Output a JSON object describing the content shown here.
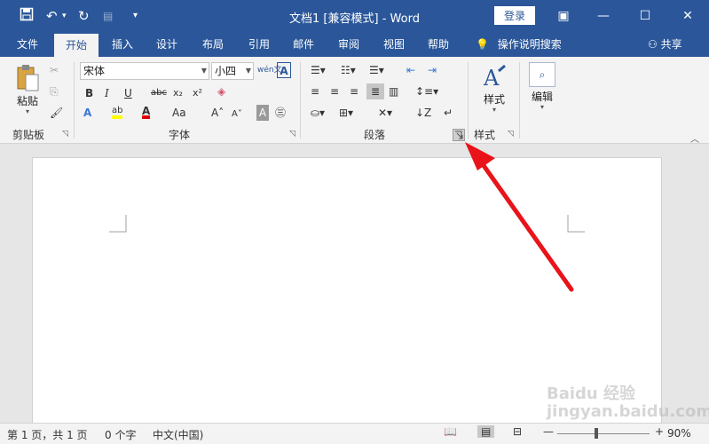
{
  "window": {
    "title": "文档1 [兼容模式]  -  Word",
    "login": "登录"
  },
  "tabs": [
    "文件",
    "开始",
    "插入",
    "设计",
    "布局",
    "引用",
    "邮件",
    "审阅",
    "视图",
    "帮助"
  ],
  "active_tab": "开始",
  "search_label": "操作说明搜索",
  "share_label": "共享",
  "ribbon": {
    "clipboard": {
      "label": "剪贴板",
      "paste": "粘贴"
    },
    "font": {
      "label": "字体",
      "name": "宋体",
      "size": "小四"
    },
    "paragraph": {
      "label": "段落"
    },
    "styles": {
      "label": "样式",
      "button": "样式"
    },
    "editing": {
      "button": "编辑"
    }
  },
  "status": {
    "page": "第 1 页，共 1 页",
    "words": "0 个字",
    "language": "中文(中国)",
    "zoom": "90%"
  },
  "watermark": "Baidu 经验  jingyan.baidu.com",
  "colors": {
    "titlebar": "#2b579a",
    "ribbon": "#f3f3f3",
    "arrow": "#e8141a"
  }
}
